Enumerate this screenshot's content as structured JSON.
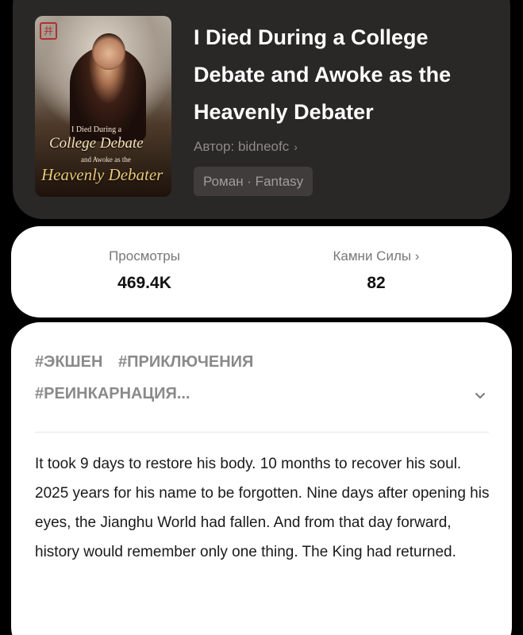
{
  "book": {
    "title": "I Died During a College Debate and Awoke as the Heavenly Debater",
    "author_label": "Автор: bidneofc",
    "author_chevron": "›",
    "genre": "Роман · Fantasy",
    "cover": {
      "seal": "井",
      "line1": "I Died During a",
      "line2": "College Debate",
      "line3": "and Awoke as the",
      "line4": "Heavenly Debater"
    }
  },
  "stats": {
    "views_label": "Просмотры",
    "views_value": "469.4K",
    "power_label": "Камни Силы ›",
    "power_value": "82"
  },
  "tags": [
    "#ЭКШЕН",
    "#ПРИКЛЮЧЕНИЯ",
    "#РЕИНКАРНАЦИЯ..."
  ],
  "description": "It took 9 days to restore his body. 10 months to recover his soul. 2025 years for his name to be forgotten. Nine days after opening his eyes, the Jianghu World had fallen. And from that day forward, history would remember only one thing. The King had returned.",
  "icons": {
    "expand": "chevron-down-icon"
  },
  "colors": {
    "header_bg": "#2a2727",
    "card_bg": "#ffffff",
    "tag_color": "#8a8a8a"
  }
}
